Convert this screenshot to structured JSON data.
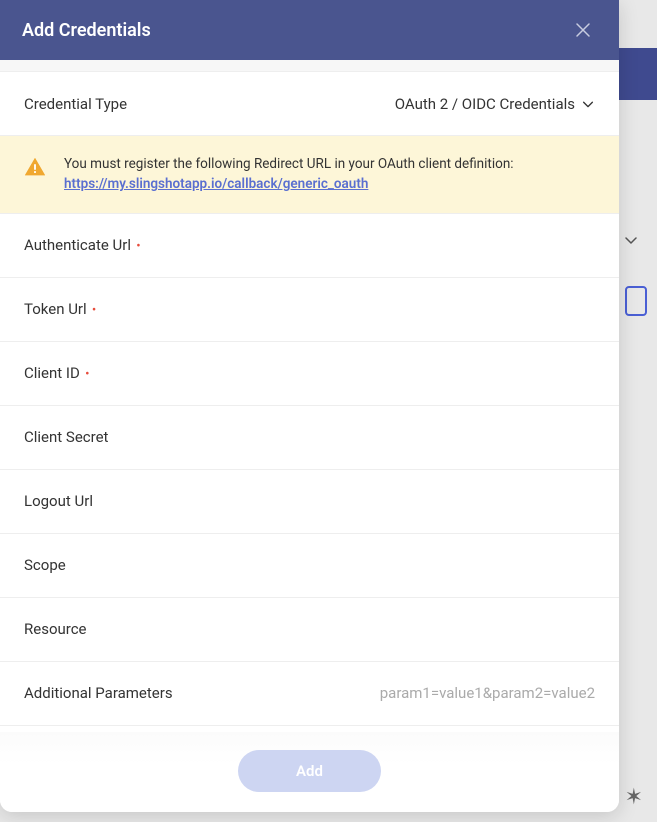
{
  "modal": {
    "title": "Add Credentials",
    "credential_type": {
      "label": "Credential Type",
      "value": "OAuth 2 / OIDC Credentials"
    },
    "alert": {
      "text_prefix": "You must register the following Redirect URL in your OAuth client definition:",
      "link": "https://my.slingshotapp.io/callback/generic_oauth"
    },
    "fields": {
      "authenticate_url": {
        "label": "Authenticate Url",
        "required": true
      },
      "token_url": {
        "label": "Token Url",
        "required": true
      },
      "client_id": {
        "label": "Client ID",
        "required": true
      },
      "client_secret": {
        "label": "Client Secret",
        "required": false
      },
      "logout_url": {
        "label": "Logout Url",
        "required": false
      },
      "scope": {
        "label": "Scope",
        "required": false
      },
      "resource": {
        "label": "Resource",
        "required": false
      },
      "additional_parameters": {
        "label": "Additional Parameters",
        "required": false,
        "placeholder": "param1=value1&param2=value2"
      }
    },
    "footer": {
      "add_label": "Add"
    }
  }
}
